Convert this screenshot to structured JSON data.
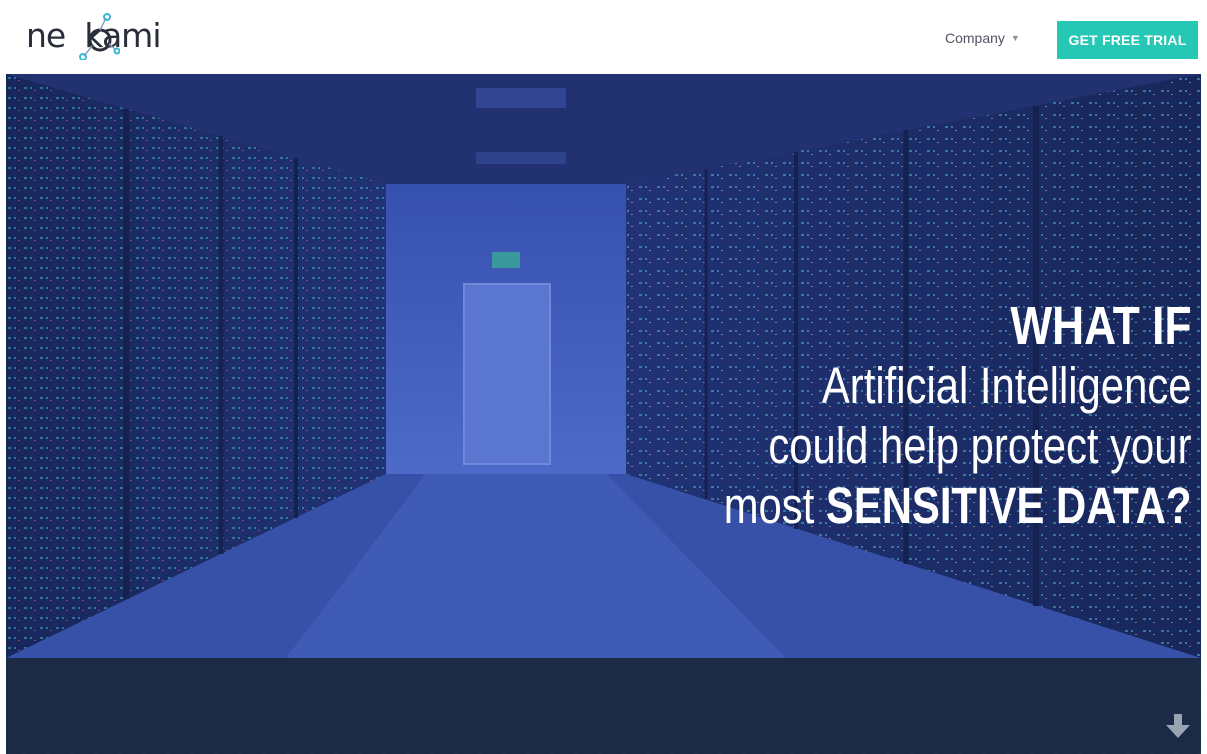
{
  "header": {
    "logo_text": "neokami",
    "nav": {
      "company_label": "Company"
    },
    "cta_label": "GET FREE TRIAL"
  },
  "hero": {
    "line1": "WHAT IF",
    "line2": "Artificial Intelligence",
    "line3": "could help protect your",
    "line4_prefix": "most ",
    "line4_emphasis": "SENSITIVE DATA?"
  },
  "colors": {
    "accent": "#27c7b5",
    "hero_blue": "#2b3d8e",
    "band": "#1b2a45"
  },
  "icons": [
    "logo-molecule-icon",
    "chevron-down-icon",
    "arrow-down-icon"
  ]
}
